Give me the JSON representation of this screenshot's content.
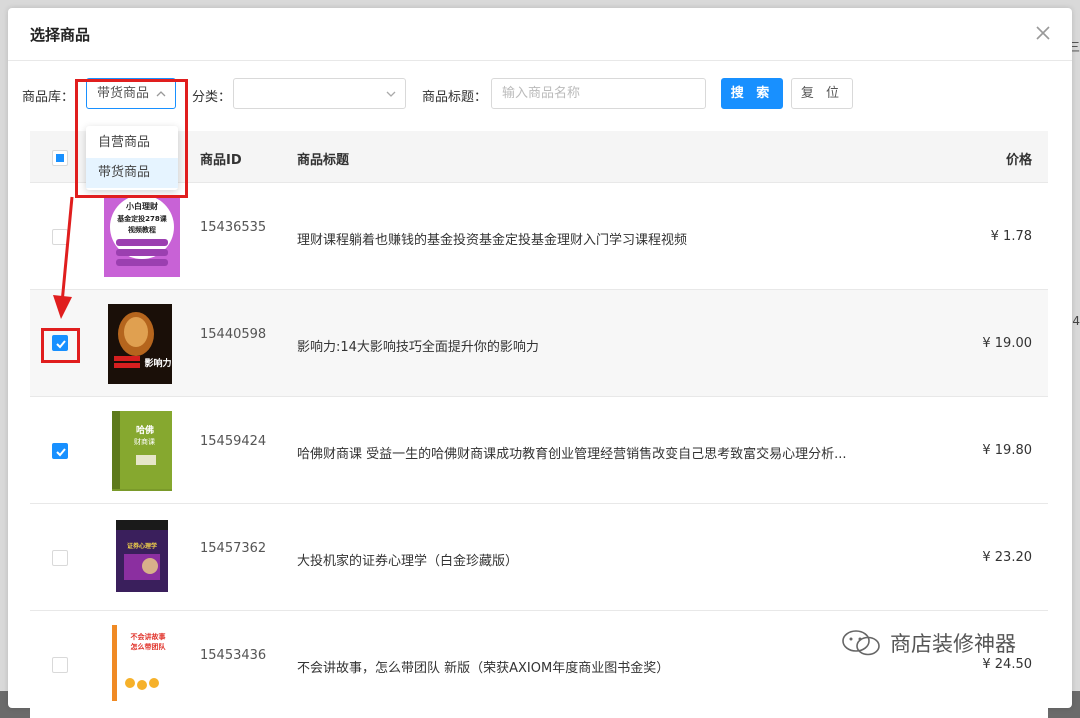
{
  "modal": {
    "title": "选择商品"
  },
  "filters": {
    "library_label": "商品库",
    "library_value": "带货商品",
    "category_label": "分类",
    "title_label": "商品标题",
    "title_placeholder": "输入商品名称",
    "search_label": "搜 索",
    "reset_label": "复 位"
  },
  "dropdown": {
    "options": [
      "自营商品",
      "带货商品"
    ],
    "selected": "带货商品"
  },
  "table": {
    "columns": [
      "商品ID",
      "商品标题",
      "价格"
    ],
    "rows": [
      {
        "id": "15436535",
        "title": "理财课程躺着也赚钱的基金投资基金定投基金理财入门学习课程视频",
        "price": "¥ 1.78",
        "checked": false
      },
      {
        "id": "15440598",
        "title": "影响力:14大影响技巧全面提升你的影响力",
        "price": "¥ 19.00",
        "checked": true
      },
      {
        "id": "15459424",
        "title": "哈佛财商课 受益一生的哈佛财商课成功教育创业管理经营销售改变自己思考致富交易心理分析...",
        "price": "¥ 19.80",
        "checked": true
      },
      {
        "id": "15457362",
        "title": "大投机家的证券心理学（白金珍藏版）",
        "price": "¥ 23.20",
        "checked": false
      },
      {
        "id": "15453436",
        "title": "不会讲故事，怎么带团队 新版（荣获AXIOM年度商业图书金奖）",
        "price": "¥ 24.50",
        "checked": false
      }
    ]
  },
  "thumbs": {
    "book1": [
      "小白理财",
      "基金定投278课",
      "视频教程"
    ],
    "book2": [
      "影响力"
    ],
    "book3": [
      "哈佛",
      "财商课"
    ],
    "book4": [
      "证券心理学"
    ],
    "book5": [
      "不会讲故事",
      "怎么带团队"
    ]
  },
  "watermark": "商店装修神器",
  "colors": {
    "primary": "#1890ff",
    "annotation_red": "#e01e1e"
  }
}
